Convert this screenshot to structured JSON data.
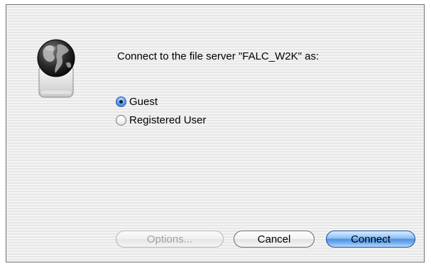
{
  "dialog": {
    "icon": "globe-server-icon",
    "message": "Connect to the file server \"FALC_W2K\" as:",
    "options": [
      {
        "label": "Guest",
        "selected": true
      },
      {
        "label": "Registered User",
        "selected": false
      }
    ],
    "buttons": {
      "options_label": "Options...",
      "options_enabled": false,
      "cancel_label": "Cancel",
      "connect_label": "Connect",
      "default_button": "Connect"
    }
  },
  "colors": {
    "accent": "#4d8fe0",
    "disabled_text": "#a2a2a2"
  }
}
